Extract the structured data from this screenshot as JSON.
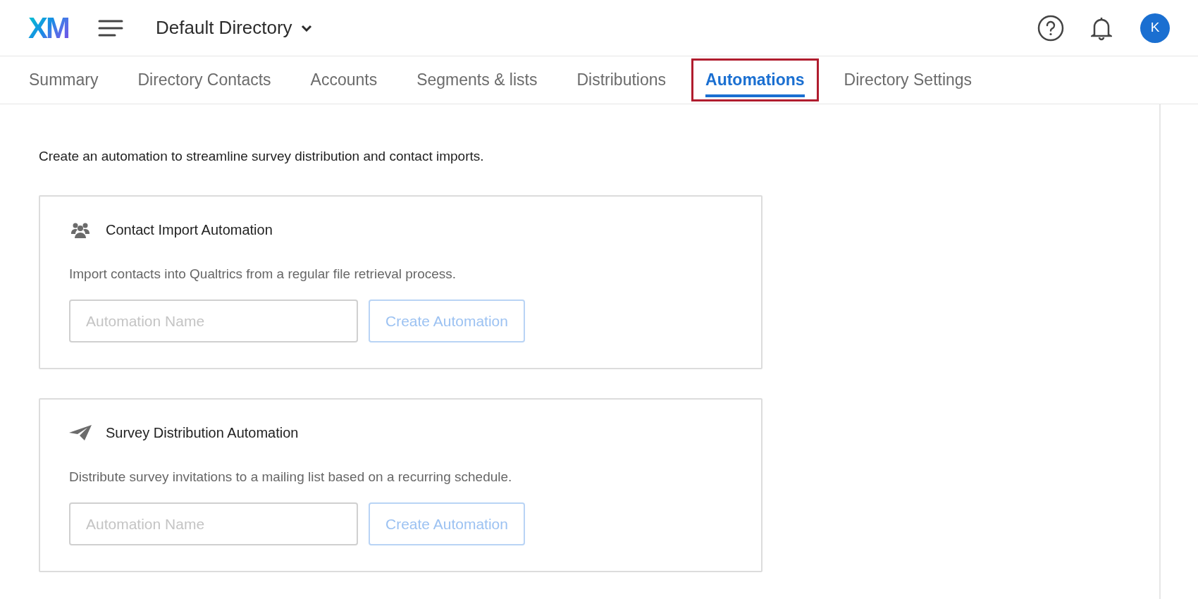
{
  "header": {
    "logo": "XM",
    "directory": "Default Directory",
    "avatar": "K"
  },
  "tabs": [
    {
      "label": "Summary",
      "selected": false,
      "highlighted": false
    },
    {
      "label": "Directory Contacts",
      "selected": false,
      "highlighted": false
    },
    {
      "label": "Accounts",
      "selected": false,
      "highlighted": false
    },
    {
      "label": "Segments & lists",
      "selected": false,
      "highlighted": false
    },
    {
      "label": "Distributions",
      "selected": false,
      "highlighted": false
    },
    {
      "label": "Automations",
      "selected": true,
      "highlighted": true
    },
    {
      "label": "Directory Settings",
      "selected": false,
      "highlighted": false
    }
  ],
  "intro": "Create an automation to streamline survey distribution and contact imports.",
  "cards": [
    {
      "kind": "contacts",
      "title": "Contact Import Automation",
      "description": "Import contacts into Qualtrics from a regular file retrieval process.",
      "placeholder": "Automation Name",
      "button": "Create Automation",
      "disabled": true
    },
    {
      "kind": "distribution",
      "title": "Survey Distribution Automation",
      "description": "Distribute survey invitations to a mailing list based on a recurring schedule.",
      "placeholder": "Automation Name",
      "button": "Create Automation",
      "disabled": true
    }
  ]
}
